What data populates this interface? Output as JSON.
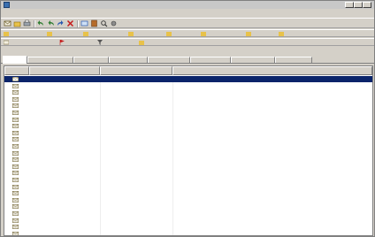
{
  "window": {
    "title": "",
    "icon": "mail-app-icon",
    "controls": [
      "minimize-icon",
      "maximize-icon",
      "close-icon"
    ]
  },
  "menubar": {
    "items": [
      "",
      "",
      "",
      "",
      "",
      ""
    ]
  },
  "toolbar": {
    "icons": [
      "new-message-icon",
      "open-icon",
      "print-icon",
      "reply-icon",
      "reply-all-icon",
      "forward-icon",
      "delete-icon",
      "send-receive-icon",
      "address-book-icon",
      "search-icon",
      "options-icon"
    ]
  },
  "quick_buttons": [
    {
      "label": "",
      "icon": "folder-icon"
    },
    {
      "label": "",
      "icon": "folder-icon"
    },
    {
      "label": "",
      "icon": "folder-icon"
    },
    {
      "label": "",
      "icon": "folder-icon"
    },
    {
      "label": "",
      "icon": "folder-icon"
    },
    {
      "label": "",
      "icon": "folder-icon"
    },
    {
      "label": "",
      "icon": "folder-icon"
    },
    {
      "label": "",
      "icon": "folder-icon"
    }
  ],
  "view_buttons": [
    {
      "label": "",
      "icon": "mail-icon"
    },
    {
      "label": "",
      "icon": "flag-icon"
    },
    {
      "label": "",
      "icon": "filter-icon"
    },
    {
      "label": "",
      "icon": "folder-icon"
    }
  ],
  "tabs": [
    {
      "label": "",
      "active": true
    },
    {
      "label": "",
      "active": false
    },
    {
      "label": "",
      "active": false
    },
    {
      "label": "",
      "active": false
    },
    {
      "label": "",
      "active": false
    },
    {
      "label": "",
      "active": false
    },
    {
      "label": "",
      "active": false
    },
    {
      "label": "",
      "active": false
    }
  ],
  "list": {
    "columns": [
      "",
      "",
      "",
      ""
    ],
    "rows": [
      {
        "status_icon": "envelope-icon",
        "received": "",
        "from": "",
        "subject": "",
        "unread": false,
        "selected": true
      },
      {
        "status_icon": "envelope-open-icon",
        "received": "",
        "from": "",
        "subject": "",
        "unread": true,
        "selected": false
      },
      {
        "status_icon": "envelope-open-icon",
        "received": "",
        "from": "",
        "subject": "",
        "unread": true,
        "selected": false
      },
      {
        "status_icon": "envelope-open-icon",
        "received": "",
        "from": "",
        "subject": "",
        "unread": false,
        "selected": false
      },
      {
        "status_icon": "envelope-open-icon",
        "received": "",
        "from": "",
        "subject": "",
        "unread": false,
        "selected": false
      },
      {
        "status_icon": "envelope-open-icon",
        "received": "",
        "from": "",
        "subject": "",
        "unread": false,
        "selected": false
      },
      {
        "status_icon": "envelope-open-icon",
        "received": "",
        "from": "",
        "subject": "",
        "unread": true,
        "selected": false
      },
      {
        "status_icon": "envelope-open-icon",
        "received": "",
        "from": "",
        "subject": "",
        "unread": true,
        "selected": false
      },
      {
        "status_icon": "envelope-open-icon",
        "received": "",
        "from": "",
        "subject": "",
        "unread": false,
        "selected": false
      },
      {
        "status_icon": "envelope-open-icon",
        "received": "",
        "from": "",
        "subject": "",
        "unread": true,
        "selected": false
      },
      {
        "status_icon": "envelope-open-icon",
        "received": "",
        "from": "",
        "subject": "",
        "unread": true,
        "selected": false
      },
      {
        "status_icon": "envelope-open-icon",
        "received": "",
        "from": "",
        "subject": "",
        "unread": false,
        "selected": false
      },
      {
        "status_icon": "envelope-open-icon",
        "received": "",
        "from": "",
        "subject": "",
        "unread": false,
        "selected": false
      },
      {
        "status_icon": "envelope-open-icon",
        "received": "",
        "from": "",
        "subject": "",
        "unread": false,
        "selected": false
      },
      {
        "status_icon": "envelope-open-icon",
        "received": "",
        "from": "",
        "subject": "",
        "unread": false,
        "selected": false
      },
      {
        "status_icon": "envelope-open-icon",
        "received": "",
        "from": "",
        "subject": "",
        "unread": false,
        "selected": false
      },
      {
        "status_icon": "envelope-open-icon",
        "received": "",
        "from": "",
        "subject": "",
        "unread": false,
        "selected": false
      },
      {
        "status_icon": "envelope-open-icon",
        "received": "",
        "from": "",
        "subject": "",
        "unread": false,
        "selected": false
      },
      {
        "status_icon": "envelope-open-icon",
        "received": "",
        "from": "",
        "subject": "",
        "unread": false,
        "selected": false
      },
      {
        "status_icon": "envelope-open-icon",
        "received": "",
        "from": "",
        "subject": "",
        "unread": false,
        "selected": false
      },
      {
        "status_icon": "envelope-open-icon",
        "received": "",
        "from": "",
        "subject": "",
        "unread": false,
        "selected": false
      },
      {
        "status_icon": "envelope-open-icon",
        "received": "",
        "from": "",
        "subject": "",
        "unread": false,
        "selected": false
      },
      {
        "status_icon": "envelope-open-icon",
        "received": "",
        "from": "",
        "subject": "",
        "unread": false,
        "selected": false
      },
      {
        "status_icon": "envelope-open-icon",
        "received": "",
        "from": "",
        "subject": "",
        "unread": false,
        "selected": false
      }
    ]
  },
  "colors": {
    "selected_row": "#0a246a",
    "unread_text": "#1a3fc6",
    "chrome": "#d4d0c8"
  }
}
